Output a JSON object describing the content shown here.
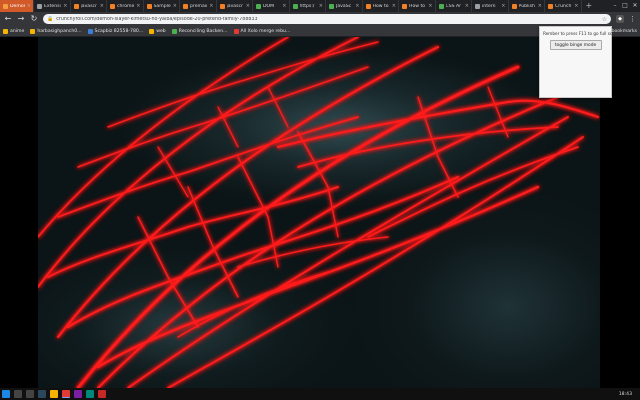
{
  "browser": {
    "tabs": [
      {
        "title": "Demon",
        "active": true,
        "color": "#f0a040"
      },
      {
        "title": "Extensi",
        "active": false,
        "color": "#9aa0a6"
      },
      {
        "title": "javascr",
        "active": false,
        "color": "#f48024"
      },
      {
        "title": "chrome",
        "active": false,
        "color": "#f48024"
      },
      {
        "title": "Sample",
        "active": false,
        "color": "#f48024"
      },
      {
        "title": "premain",
        "active": false,
        "color": "#f48024"
      },
      {
        "title": "javascr",
        "active": false,
        "color": "#f48024"
      },
      {
        "title": "DOM",
        "active": false,
        "color": "#4caf50"
      },
      {
        "title": "https:/",
        "active": false,
        "color": "#4caf50"
      },
      {
        "title": "JavaSc",
        "active": false,
        "color": "#4caf50"
      },
      {
        "title": "How to",
        "active": false,
        "color": "#f48024"
      },
      {
        "title": "How to",
        "active": false,
        "color": "#f48024"
      },
      {
        "title": "CSS Ar",
        "active": false,
        "color": "#4caf50"
      },
      {
        "title": "intern",
        "active": false,
        "color": "#9aa0a6"
      },
      {
        "title": "Publish",
        "active": false,
        "color": "#f48024"
      },
      {
        "title": "Crunch",
        "active": false,
        "color": "#f48024"
      }
    ],
    "new_tab_icon": "+",
    "url": "crunchyroll.com/demon-slayer-kimetsu-no-yaiba/episode-20-pretend-family-788833",
    "toolbar_icons": [
      "back-icon",
      "forward-icon",
      "reload-icon",
      "lock-icon",
      "star-icon",
      "extension-icon",
      "menu-icon"
    ],
    "bookmarks": [
      {
        "label": "anime",
        "color": "#f5b400"
      },
      {
        "label": "harbasighpanch0...",
        "color": "#f5b400"
      },
      {
        "label": "Scapbiz 82558-780...",
        "color": "#3b7dd8"
      },
      {
        "label": "web",
        "color": "#f5b400"
      },
      {
        "label": "Reconciling Backen...",
        "color": "#4caf50"
      },
      {
        "label": "All Xolo merge rebu...",
        "color": "#e53935"
      }
    ],
    "bookmarks_right": "Other bookmarks"
  },
  "popup": {
    "hint": "Rember to press F11 to go full screen!",
    "button_label": "toggle binge mode"
  },
  "taskbar": {
    "clock": "18:43",
    "icons": [
      {
        "name": "start-icon",
        "color": "#1e88e5"
      },
      {
        "name": "search-icon",
        "color": "#444"
      },
      {
        "name": "task-view-icon",
        "color": "#444"
      },
      {
        "name": "steam-icon",
        "color": "#2a475e"
      },
      {
        "name": "explorer-icon",
        "color": "#f5b400"
      },
      {
        "name": "chrome-icon",
        "color": "#e53935"
      },
      {
        "name": "app-icon",
        "color": "#7b1fa2"
      },
      {
        "name": "app2-icon",
        "color": "#00897b"
      },
      {
        "name": "app3-icon",
        "color": "#c62828"
      }
    ]
  },
  "colors": {
    "accent_tab": "#d25a28",
    "web_glow": "#ff1a1a"
  }
}
